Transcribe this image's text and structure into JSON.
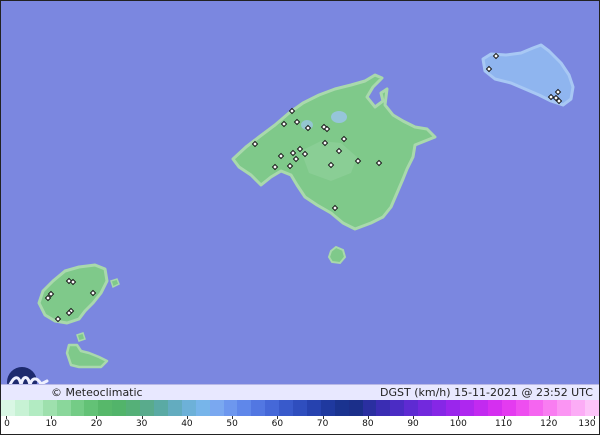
{
  "map": {
    "sea_color": "#7b87e0",
    "land_color": "#7fc98a",
    "land_light_color": "#98d69f",
    "menorca_color": "#8fb5ef",
    "coast_color": "#a9d9ac",
    "islands": [
      "mallorca",
      "menorca",
      "ibiza",
      "formentera",
      "cabrera"
    ],
    "station_marker": "diamond"
  },
  "footer": {
    "credit": "© Meteoclimatic",
    "variable": "DGST (km/h)",
    "datetime": "15-11-2021 @ 23:52 UTC",
    "title": "DGST (km/h)  15-11-2021 @ 23:52 UTC",
    "logo_icon": "meteoclimatic-logo-icon"
  },
  "legend": {
    "ticks": [
      "0",
      "10",
      "20",
      "30",
      "40",
      "50",
      "60",
      "70",
      "80",
      "90",
      "100",
      "110",
      "120",
      "130"
    ],
    "min": 0,
    "max": 130,
    "colors": [
      "#d9f7e4",
      "#c7f2d4",
      "#b2ebc2",
      "#9ee0ad",
      "#8ad79b",
      "#74cc86",
      "#63c276",
      "#57b86a",
      "#52b46a",
      "#55b078",
      "#59ab8c",
      "#5aaaa4",
      "#63acbf",
      "#6db1d8",
      "#77b5ea",
      "#7aa8f0",
      "#6d97ee",
      "#5f87ea",
      "#5277e2",
      "#4568d8",
      "#395acb",
      "#2f4ebe",
      "#2642af",
      "#1f399f",
      "#1a338f",
      "#1b2f8a",
      "#2a2fa0",
      "#3a2db3",
      "#4b2cc4",
      "#5e2bd2",
      "#7229dd",
      "#8627e6",
      "#9a26ec",
      "#ae27ef",
      "#c22af0",
      "#d52ff0",
      "#e43bf0",
      "#ee4ef0",
      "#f565f0",
      "#f97df1",
      "#fb95f3",
      "#fcacf6",
      "#fdc4f9"
    ]
  }
}
